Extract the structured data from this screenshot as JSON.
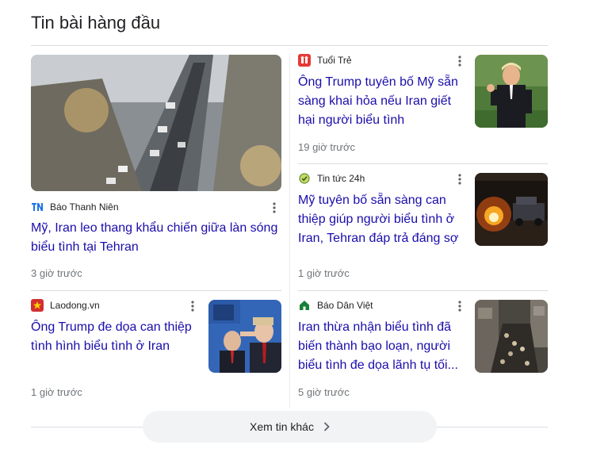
{
  "section": {
    "title": "Tin bài hàng đầu"
  },
  "stories": [
    {
      "source": "Báo Thanh Niên",
      "headline": "Mỹ, Iran leo thang khẩu chiến giữa làn sóng biểu tình tại Tehran",
      "time": "3 giờ trước",
      "logo_icon": "thanh-nien-logo-icon",
      "logo_color": "#1a73e8"
    },
    {
      "source": "Tuổi Trẻ",
      "headline": "Ông Trump tuyên bố Mỹ sẵn sàng khai hỏa nếu Iran giết hại người biểu tình",
      "time": "19 giờ trước",
      "logo_icon": "tuoi-tre-logo-icon",
      "logo_color": "#e53935"
    },
    {
      "source": "Tin tức 24h",
      "headline": "Mỹ tuyên bố sẵn sàng can thiệp giúp người biểu tình ở Iran, Tehran đáp trả đáng sợ",
      "time": "1 giờ trước",
      "logo_icon": "tin-tuc-24h-logo-icon",
      "logo_color": "#6a8f2e"
    },
    {
      "source": "Laodong.vn",
      "headline": "Ông Trump đe dọa can thiệp tình hình biểu tình ở Iran",
      "time": "1 giờ trước",
      "logo_icon": "laodong-logo-icon",
      "logo_color": "#d32f2f"
    },
    {
      "source": "Báo Dân Việt",
      "headline": "Iran thừa nhận biểu tình đã biến thành bạo loạn, người biểu tình đe dọa lãnh tụ tối...",
      "time": "5 giờ trước",
      "logo_icon": "dan-viet-logo-icon",
      "logo_color": "#188038"
    }
  ],
  "more_button": {
    "label": "Xem tin khác",
    "icon": "chevron-right-icon"
  },
  "colors": {
    "headline": "#1a0dab",
    "meta": "#70757a",
    "divider": "#dadce0",
    "button_bg": "#f1f3f4"
  }
}
